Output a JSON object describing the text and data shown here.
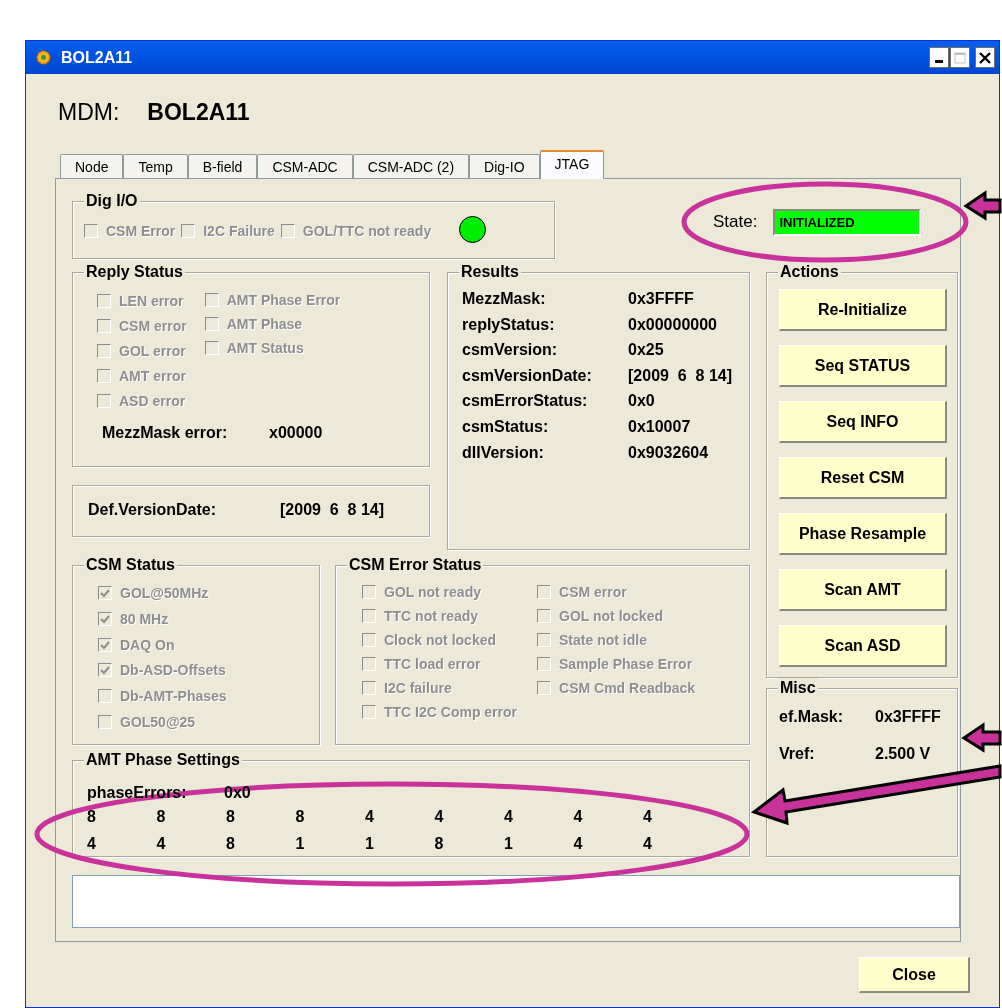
{
  "window": {
    "title": "BOL2A11"
  },
  "header": {
    "label": "MDM:",
    "value": "BOL2A11"
  },
  "tabs": [
    {
      "label": "Node",
      "selected": false
    },
    {
      "label": "Temp",
      "selected": false
    },
    {
      "label": "B-field",
      "selected": false
    },
    {
      "label": "CSM-ADC",
      "selected": false
    },
    {
      "label": "CSM-ADC (2)",
      "selected": false
    },
    {
      "label": "Dig-IO",
      "selected": false
    },
    {
      "label": "JTAG",
      "selected": true
    }
  ],
  "dig_io": {
    "title": "Dig I/O",
    "checkboxes": [
      {
        "label": "CSM Error",
        "checked": false,
        "disabled": true
      },
      {
        "label": "I2C Failure",
        "checked": false,
        "disabled": true
      },
      {
        "label": "GOL/TTC not ready",
        "checked": false,
        "disabled": true
      }
    ],
    "indicator": {
      "on": true
    }
  },
  "state": {
    "label": "State:",
    "value": "INITIALIZED"
  },
  "reply_status": {
    "title": "Reply Status",
    "columns": [
      [
        {
          "label": "LEN error",
          "checked": false,
          "disabled": true
        },
        {
          "label": "CSM error",
          "checked": false,
          "disabled": true
        },
        {
          "label": "GOL error",
          "checked": false,
          "disabled": true
        },
        {
          "label": "AMT error",
          "checked": false,
          "disabled": true
        },
        {
          "label": "ASD error",
          "checked": false,
          "disabled": true
        }
      ],
      [
        {
          "label": "AMT Phase Error",
          "checked": false,
          "disabled": true
        },
        {
          "label": "AMT Phase",
          "checked": false,
          "disabled": true
        },
        {
          "label": "AMT Status",
          "checked": false,
          "disabled": true
        }
      ]
    ],
    "mezzmask_error": {
      "label": "MezzMask error:",
      "value": "x00000"
    }
  },
  "def_version_date": {
    "label": "Def.VersionDate:",
    "value": "[2009  6  8 14]"
  },
  "results": {
    "title": "Results",
    "rows": [
      {
        "label": "MezzMask:",
        "value": "0x3FFFF"
      },
      {
        "label": "replyStatus:",
        "value": "0x00000000"
      },
      {
        "label": "csmVersion:",
        "value": "0x25"
      },
      {
        "label": "csmVersionDate:",
        "value": "[2009  6  8 14]"
      },
      {
        "label": "csmErrorStatus:",
        "value": "0x0"
      },
      {
        "label": "csmStatus:",
        "value": "0x10007"
      },
      {
        "label": "dllVersion:",
        "value": "0x9032604"
      }
    ]
  },
  "actions": {
    "title": "Actions",
    "buttons": [
      "Re-Initialize",
      "Seq STATUS",
      "Seq INFO",
      "Reset CSM",
      "Phase Resample",
      "Scan AMT",
      "Scan ASD"
    ]
  },
  "csm_status": {
    "title": "CSM Status",
    "checkboxes": [
      {
        "label": "GOL@50MHz",
        "checked": true,
        "disabled": true
      },
      {
        "label": "80 MHz",
        "checked": true,
        "disabled": true
      },
      {
        "label": "DAQ On",
        "checked": true,
        "disabled": true
      },
      {
        "label": "Db-ASD-Offsets",
        "checked": true,
        "disabled": true
      },
      {
        "label": "Db-AMT-Phases",
        "checked": false,
        "disabled": true
      },
      {
        "label": "GOL50@25",
        "checked": false,
        "disabled": true
      }
    ]
  },
  "csm_error_status": {
    "title": "CSM Error Status",
    "columns": [
      [
        {
          "label": "GOL not ready",
          "checked": false,
          "disabled": true
        },
        {
          "label": "TTC not ready",
          "checked": false,
          "disabled": true
        },
        {
          "label": "Clock not locked",
          "checked": false,
          "disabled": true
        },
        {
          "label": "TTC load error",
          "checked": false,
          "disabled": true
        },
        {
          "label": "I2C failure",
          "checked": false,
          "disabled": true
        },
        {
          "label": "TTC I2C Comp error",
          "checked": false,
          "disabled": true
        }
      ],
      [
        {
          "label": "CSM error",
          "checked": false,
          "disabled": true
        },
        {
          "label": "GOL not locked",
          "checked": false,
          "disabled": true
        },
        {
          "label": "State not idle",
          "checked": false,
          "disabled": true
        },
        {
          "label": "Sample Phase Error",
          "checked": false,
          "disabled": true
        },
        {
          "label": "CSM Cmd Readback",
          "checked": false,
          "disabled": true
        }
      ]
    ]
  },
  "misc": {
    "title": "Misc",
    "rows": [
      {
        "label": "ef.Mask:",
        "value": "0x3FFFF"
      },
      {
        "label": "Vref:",
        "value": "2.500 V"
      }
    ]
  },
  "amt_phase_settings": {
    "title": "AMT Phase Settings",
    "phase_errors": {
      "label": "phaseErrors:",
      "value": "0x0"
    },
    "rows": [
      [
        "8",
        "8",
        "8",
        "8",
        "4",
        "4",
        "4",
        "4",
        "4"
      ],
      [
        "4",
        "4",
        "8",
        "1",
        "1",
        "8",
        "1",
        "4",
        "4"
      ]
    ]
  },
  "buttons": [
    {
      "label": "Close"
    }
  ]
}
